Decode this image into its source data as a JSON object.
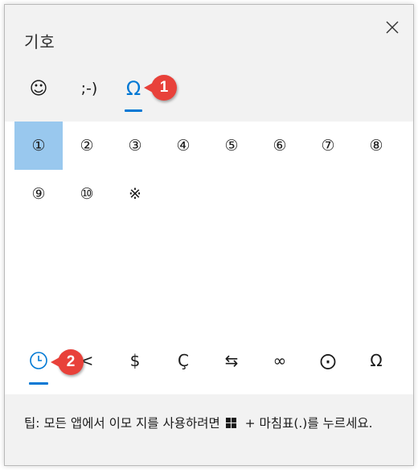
{
  "panel": {
    "title": "기호"
  },
  "category_tabs": [
    {
      "label": "☺",
      "icon": "smiley-icon"
    },
    {
      "label": ";-)",
      "icon": "kaomoji"
    },
    {
      "label": "Ω",
      "icon": "omega-icon"
    }
  ],
  "annotations": {
    "badge_1": "1",
    "badge_2": "2"
  },
  "symbols": [
    "①",
    "②",
    "③",
    "④",
    "⑤",
    "⑥",
    "⑦",
    "⑧",
    "⑨",
    "⑩",
    "※"
  ],
  "bottom_tabs": [
    {
      "label": "",
      "icon": "clock-icon"
    },
    {
      "label": "<"
    },
    {
      "label": "$"
    },
    {
      "label": "Ç"
    },
    {
      "label": "⇆"
    },
    {
      "label": "∞"
    },
    {
      "label": "⨀"
    },
    {
      "label": "Ω"
    }
  ],
  "tip": {
    "before": "팁: 모든 앱에서 이모 지를 사용하려면",
    "after": "+ 마침표(.)를 누르세요."
  },
  "colors": {
    "accent": "#0078d4",
    "selected_cell": "#99c8ee",
    "badge": "#e8413a",
    "panel_bg": "#f2f2f2"
  }
}
